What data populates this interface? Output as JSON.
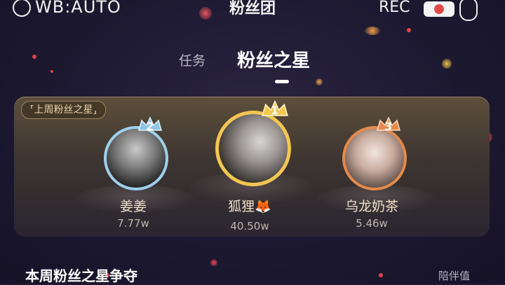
{
  "top_bar": {
    "wb_label": "WB:AUTO",
    "title": "粉丝团",
    "rec_label": "REC"
  },
  "tabs": [
    {
      "label": "任务",
      "active": false
    },
    {
      "label": "粉丝之星",
      "active": true
    }
  ],
  "card": {
    "tag": "上周粉丝之星",
    "podium": [
      {
        "rank": "1",
        "name": "狐狸",
        "name_emoji": "🦊",
        "value": "40.50w",
        "ring_color": "#f3c552"
      },
      {
        "rank": "2",
        "name": "姜姜",
        "value": "7.77w",
        "ring_color": "#9fd0ec"
      },
      {
        "rank": "3",
        "name": "乌龙奶茶",
        "value": "5.46w",
        "ring_color": "#e48a4c"
      }
    ]
  },
  "section": {
    "title": "本周粉丝之星争夺",
    "right_label": "陪伴值"
  },
  "colors": {
    "background": "#1e1a32",
    "gold": "#f3c552",
    "silver": "#9fd0ec",
    "bronze": "#e48a4c",
    "spark": "#e0454a"
  }
}
